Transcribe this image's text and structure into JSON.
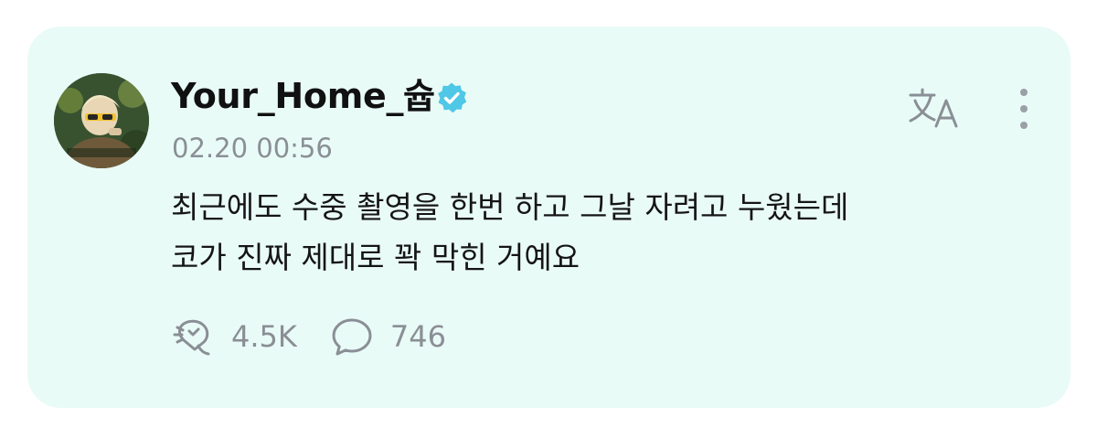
{
  "post": {
    "author": {
      "username": "Your_Home_슙",
      "verified": true,
      "avatar_icon": "avatar-photo"
    },
    "timestamp": "02.20 00:56",
    "text_lines": [
      "최근에도 수중 촬영을 한번 하고 그날 자려고 누웠는데",
      "코가 진짜 제대로 꽉 막힌 거예요"
    ],
    "actions": {
      "like_count": "4.5K",
      "comment_count": "746"
    },
    "icons": {
      "translate": "translate-icon",
      "more": "more-vertical-icon",
      "like": "like-icon",
      "comment": "comment-icon",
      "verified": "verified-badge-icon"
    }
  },
  "colors": {
    "card_background": "#e9fbf7",
    "verified_badge": "#4fc7e6",
    "muted_text": "#8a8f95",
    "primary_text": "#111111"
  }
}
